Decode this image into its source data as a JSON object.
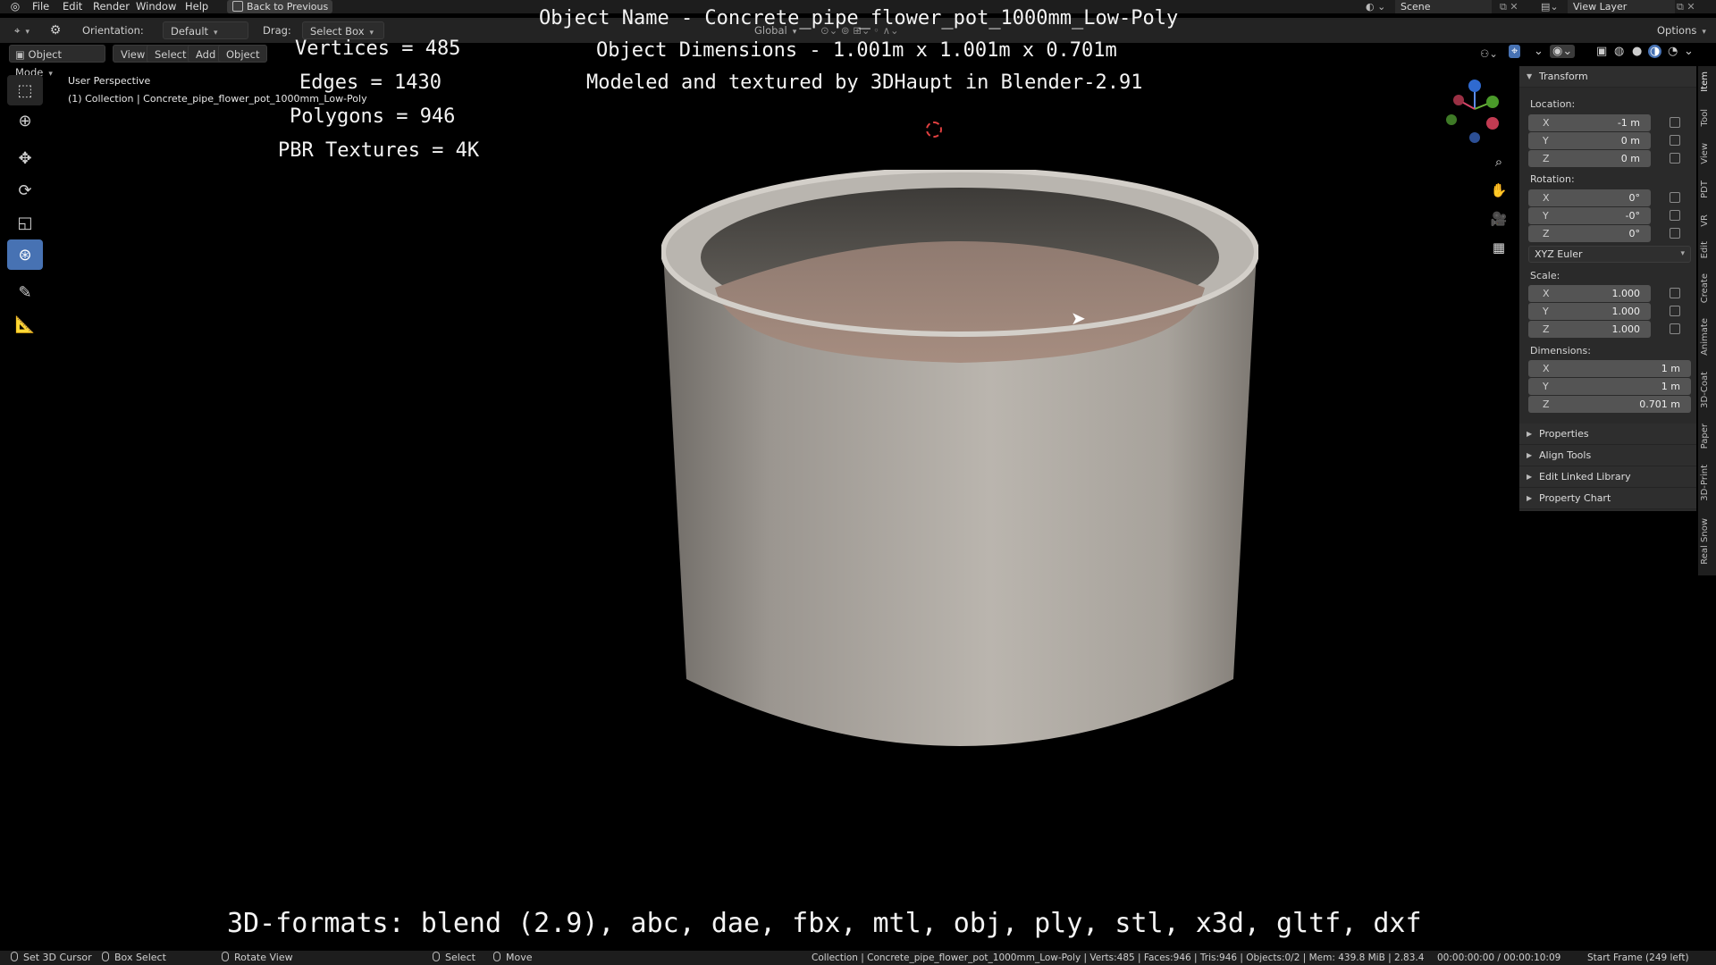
{
  "menubar": {
    "items": [
      "File",
      "Edit",
      "Render",
      "Window",
      "Help"
    ],
    "back_button": "Back to Previous",
    "scene": "Scene",
    "view_layer": "View Layer"
  },
  "header": {
    "orientation_label": "Orientation:",
    "orientation_value": "Default",
    "drag_label": "Drag:",
    "drag_value": "Select Box",
    "transform_orientation": "Global",
    "options": "Options",
    "mode": "Object Mode",
    "menus": [
      "View",
      "Select",
      "Add",
      "Object"
    ]
  },
  "viewport": {
    "perspective": "User Perspective",
    "collection_line": "(1) Collection | Concrete_pipe_flower_pot_1000mm_Low-Poly"
  },
  "overlay": {
    "vertices": "Vertices = 485",
    "edges": "Edges = 1430",
    "polygons": "Polygons = 946",
    "textures": "PBR Textures = 4K",
    "object_name": "Object Name - Concrete_pipe_flower_pot_1000mm_Low-Poly",
    "dimensions": "Object Dimensions -  1.001m x 1.001m x 0.701m",
    "credit": "Modeled and textured by 3DHaupt in Blender-2.91",
    "formats": "3D-formats: blend (2.9), abc, dae, fbx, mtl, obj, ply, stl, x3d, gltf, dxf"
  },
  "npanel": {
    "transform": "Transform",
    "location_label": "Location:",
    "location": [
      {
        "axis": "X",
        "value": "-1 m"
      },
      {
        "axis": "Y",
        "value": "0 m"
      },
      {
        "axis": "Z",
        "value": "0 m"
      }
    ],
    "rotation_label": "Rotation:",
    "rotation": [
      {
        "axis": "X",
        "value": "0°"
      },
      {
        "axis": "Y",
        "value": "-0°"
      },
      {
        "axis": "Z",
        "value": "0°"
      }
    ],
    "rotation_mode": "XYZ Euler",
    "scale_label": "Scale:",
    "scale": [
      {
        "axis": "X",
        "value": "1.000"
      },
      {
        "axis": "Y",
        "value": "1.000"
      },
      {
        "axis": "Z",
        "value": "1.000"
      }
    ],
    "dimensions_label": "Dimensions:",
    "dimensions": [
      {
        "axis": "X",
        "value": "1 m"
      },
      {
        "axis": "Y",
        "value": "1 m"
      },
      {
        "axis": "Z",
        "value": "0.701 m"
      }
    ],
    "sections": [
      "Properties",
      "Align Tools",
      "Edit Linked Library",
      "Property Chart"
    ]
  },
  "vtabs": [
    "Item",
    "Tool",
    "View",
    "PDT",
    "VR",
    "Edit",
    "Create",
    "Animate",
    "3D-Coat",
    "Paper",
    "3D-Print",
    "Real Snow"
  ],
  "statusbar": {
    "set_cursor": "Set 3D Cursor",
    "box_select": "Box Select",
    "rotate_view": "Rotate View",
    "select": "Select",
    "move": "Move",
    "stats": "Collection | Concrete_pipe_flower_pot_1000mm_Low-Poly | Verts:485 | Faces:946 | Tris:946 | Objects:0/2 | Mem: 439.8 MiB | 2.83.4",
    "time": "00:00:00:00 / 00:00:10:09",
    "frame": "Start Frame (249 left)"
  },
  "colors": {
    "accent": "#4772b3",
    "panel_bg": "#2a2a2a",
    "field_bg": "#545454",
    "viewport_bg": "#000000"
  }
}
